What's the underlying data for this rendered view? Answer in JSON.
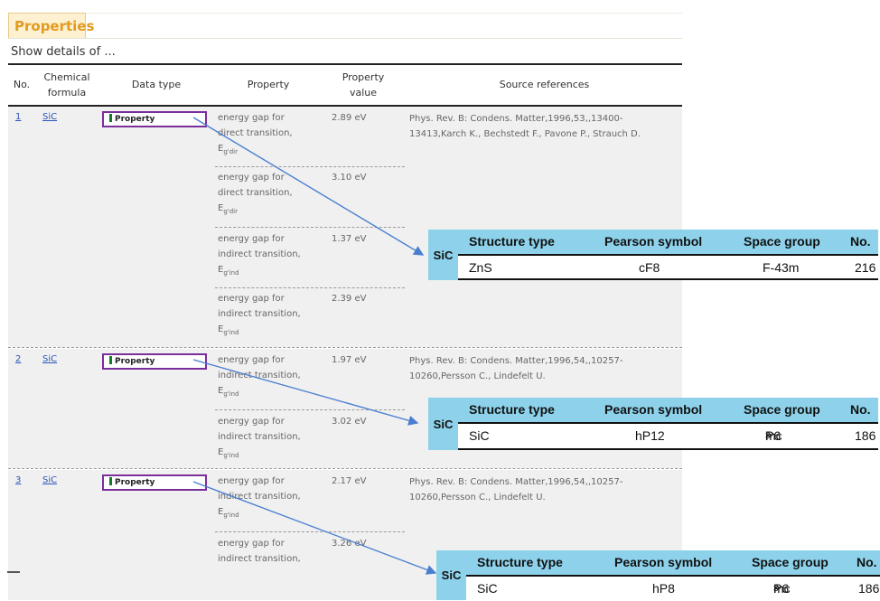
{
  "tab_label": "Properties",
  "show_details": "Show details of ...",
  "columns": {
    "no": "No.",
    "formula_1": "Chemical",
    "formula_2": "formula",
    "data_type": "Data type",
    "property": "Property",
    "value_1": "Property",
    "value_2": "value",
    "refs": "Source references"
  },
  "rows": [
    {
      "no": "1",
      "formula": "SiC",
      "data_type": "Property",
      "ref_1": "Phys. Rev. B: Condens. Matter,1996,53,,13400-",
      "ref_2": "13413,Karch K., Bechstedt F., Pavone P., Strauch D.",
      "entries": [
        {
          "line1": "energy gap for",
          "line2": "direct transition,",
          "sym": "E",
          "sub": "g",
          "tail": "'dir",
          "value": "2.89 eV"
        },
        {
          "line1": "energy gap for",
          "line2": "direct transition,",
          "sym": "E",
          "sub": "g",
          "tail": "'dir",
          "value": "3.10 eV"
        },
        {
          "line1": "energy gap for",
          "line2": "indirect transition,",
          "sym": "E",
          "sub": "g",
          "tail": "'ind",
          "value": "1.37 eV"
        },
        {
          "line1": "energy gap for",
          "line2": "indirect transition,",
          "sym": "E",
          "sub": "g",
          "tail": "'ind",
          "value": "2.39 eV"
        }
      ]
    },
    {
      "no": "2",
      "formula": "SiC",
      "data_type": "Property",
      "ref_1": "Phys. Rev. B: Condens. Matter,1996,54,,10257-",
      "ref_2": "10260,Persson C., Lindefelt U.",
      "entries": [
        {
          "line1": "energy gap for",
          "line2": "indirect transition,",
          "sym": "E",
          "sub": "g",
          "tail": "'ind",
          "value": "1.97 eV"
        },
        {
          "line1": "energy gap for",
          "line2": "indirect transition,",
          "sym": "E",
          "sub": "g",
          "tail": "'ind",
          "value": "3.02 eV"
        }
      ]
    },
    {
      "no": "3",
      "formula": "SiC",
      "data_type": "Property",
      "ref_1": "Phys. Rev. B: Condens. Matter,1996,54,,10257-",
      "ref_2": "10260,Persson C., Lindefelt U.",
      "entries": [
        {
          "line1": "energy gap for",
          "line2": "indirect transition,",
          "sym": "E",
          "sub": "g",
          "tail": "'ind",
          "value": "2.17 eV"
        },
        {
          "line1": "energy gap for",
          "line2": "indirect transition,",
          "value": "3.26 eV"
        }
      ]
    }
  ],
  "popups": [
    {
      "label": "SiC",
      "headers": [
        "Structure type",
        "Pearson symbol",
        "Space group",
        "No."
      ],
      "structure": "ZnS",
      "pearson": "cF8",
      "sg": "F-43m",
      "sg_sub": "",
      "sg_tail": "",
      "number": "216"
    },
    {
      "label": "SiC",
      "headers": [
        "Structure type",
        "Pearson symbol",
        "Space group",
        "No."
      ],
      "structure": "SiC",
      "pearson": "hP12",
      "sg": "P6",
      "sg_sub": "3",
      "sg_tail": "mc",
      "number": "186"
    },
    {
      "label": "SiC",
      "headers": [
        "Structure type",
        "Pearson symbol",
        "Space group",
        "No."
      ],
      "structure": "SiC",
      "pearson": "hP8",
      "sg": "P6",
      "sg_sub": "3",
      "sg_tail": "mc",
      "number": "186"
    }
  ],
  "colors": {
    "tab_text": "#e29a1f",
    "link": "#2a55b8",
    "datatype_border": "#7a2e9a",
    "popup_header": "#8dd2ea",
    "arrow": "#4a7fd0"
  }
}
